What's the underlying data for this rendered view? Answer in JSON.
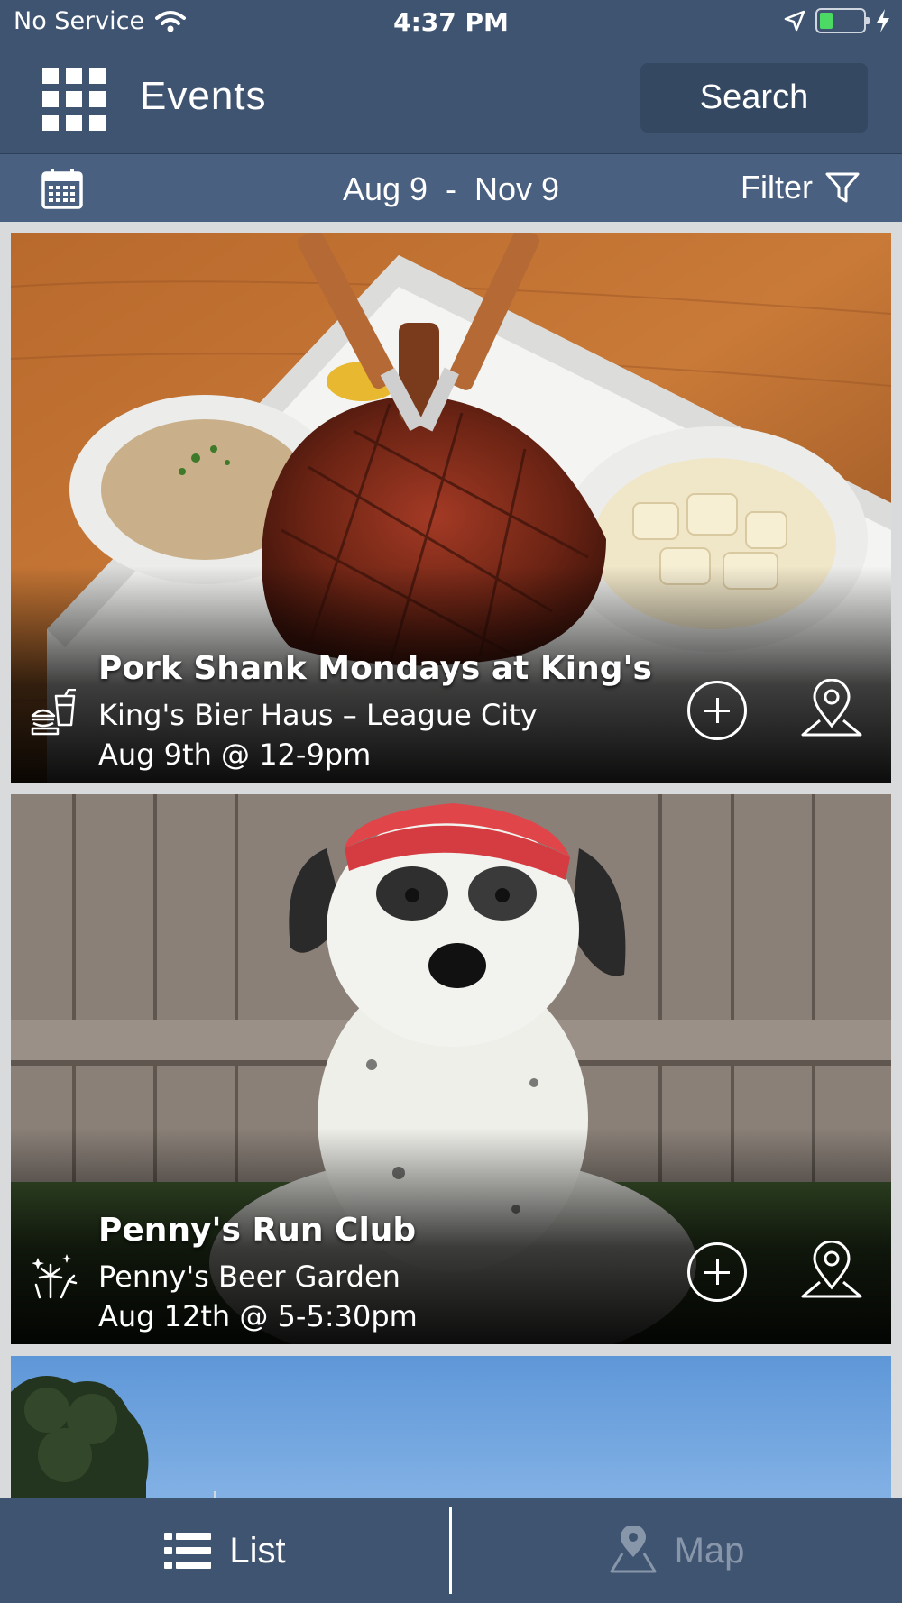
{
  "status_bar": {
    "carrier": "No Service",
    "time": "4:37 PM",
    "battery_level": 0.2
  },
  "header": {
    "title": "Events",
    "search_label": "Search"
  },
  "filter_bar": {
    "date_range": "Aug 9  -  Nov 9",
    "filter_label": "Filter"
  },
  "events": [
    {
      "title": "Pork Shank Mondays at King's",
      "venue": "King's Bier Haus – League City",
      "time": "Aug 9th @ 12-9pm",
      "category_icon": "food-drink-icon"
    },
    {
      "title": "Penny's Run Club",
      "venue": "Penny's Beer Garden",
      "time": "Aug 12th @ 5-5:30pm",
      "category_icon": "fireworks-icon"
    }
  ],
  "tabs": {
    "list_label": "List",
    "map_label": "Map",
    "active": "list"
  },
  "colors": {
    "header_bg": "#3f5471",
    "filter_bg": "#4a6080",
    "search_bg": "#344862",
    "inactive_tab": "#8896aa"
  }
}
